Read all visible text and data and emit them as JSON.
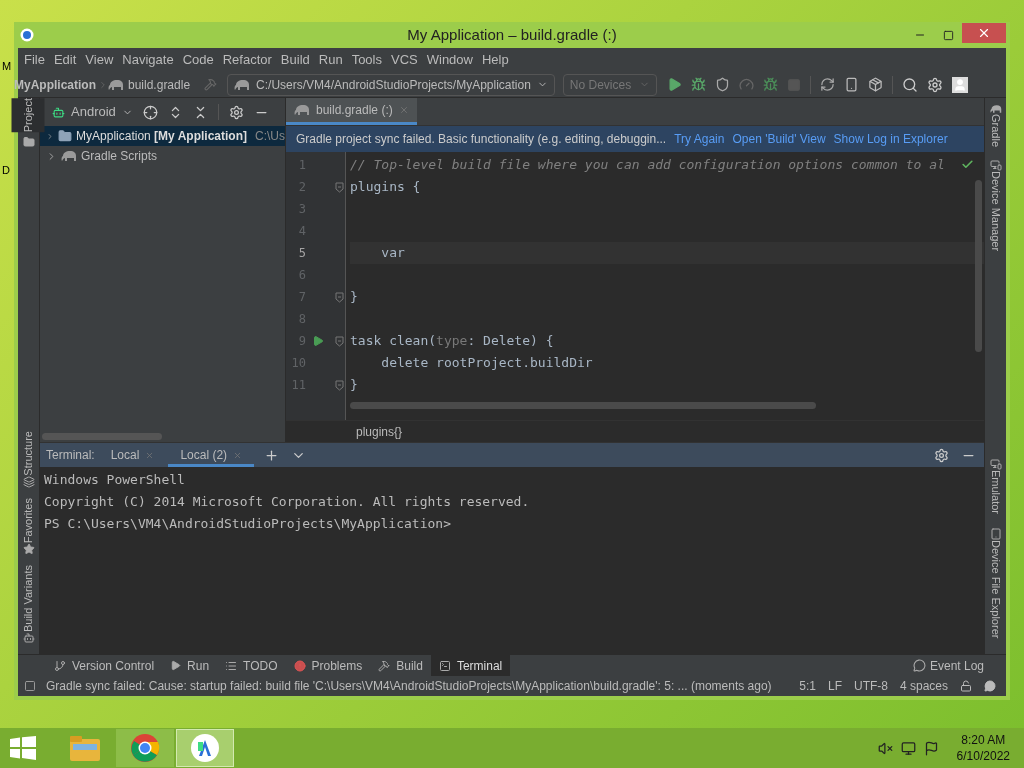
{
  "desktop": {
    "icon_labels": [
      "M",
      "D"
    ]
  },
  "window": {
    "title": "My Application – build.gradle (:)"
  },
  "menu": [
    "File",
    "Edit",
    "View",
    "Navigate",
    "Code",
    "Refactor",
    "Build",
    "Run",
    "Tools",
    "VCS",
    "Window",
    "Help"
  ],
  "navbar": {
    "project": "MyApplication",
    "file": "build.gradle",
    "config": "C:/Users/VM4/AndroidStudioProjects/MyApplication",
    "devices": {
      "label": "No Devices",
      "disabled": true
    }
  },
  "left_stripe": [
    {
      "label": "Project",
      "selected": true
    },
    {
      "label": "Structure",
      "selected": false
    },
    {
      "label": "Favorites",
      "selected": false
    },
    {
      "label": "Build Variants",
      "selected": false
    }
  ],
  "right_stripe": [
    {
      "label": "Gradle"
    },
    {
      "label": "Device Manager"
    },
    {
      "label": "Emulator"
    },
    {
      "label": "Device File Explorer"
    }
  ],
  "project_panel": {
    "view": "Android",
    "tree": [
      {
        "label": "MyApplication **[My Application]**",
        "path": "C:\\Us",
        "kind": "module",
        "expanded": false,
        "selected": true
      },
      {
        "label": "Gradle Scripts",
        "kind": "gradle",
        "expanded": false,
        "selected": false
      }
    ]
  },
  "editor": {
    "tabs": [
      {
        "label": "build.gradle (:)",
        "selected": true
      }
    ],
    "banner": {
      "message": "Gradle project sync failed. Basic functionality (e.g. editing, debuggin...",
      "links": [
        "Try Again",
        "Open 'Build' View",
        "Show Log in Explorer"
      ]
    },
    "lines": [
      {
        "number": "1",
        "fold": false,
        "run": false,
        "selected": false,
        "segments": [
          {
            "kind": "comment",
            "text": "// Top-level build file where you can add configuration options common to al"
          }
        ]
      },
      {
        "number": "2",
        "fold": true,
        "run": false,
        "selected": false,
        "segments": [
          {
            "kind": "text",
            "text": "plugins {"
          }
        ]
      },
      {
        "number": "3",
        "fold": false,
        "run": false,
        "selected": false
      },
      {
        "number": "4",
        "fold": false,
        "run": false,
        "selected": false
      },
      {
        "number": "5",
        "fold": false,
        "run": false,
        "selected": true,
        "segments": [
          {
            "kind": "text",
            "text": "    var"
          }
        ]
      },
      {
        "number": "6",
        "fold": false,
        "run": false,
        "selected": false
      },
      {
        "number": "7",
        "fold": true,
        "run": false,
        "selected": false,
        "segments": [
          {
            "kind": "text",
            "text": "}"
          }
        ]
      },
      {
        "number": "8",
        "fold": false,
        "run": false,
        "selected": false
      },
      {
        "number": "9",
        "fold": true,
        "run": true,
        "selected": false,
        "segments": [
          {
            "kind": "text",
            "text": "task clean("
          },
          {
            "kind": "param",
            "text": "type"
          },
          {
            "kind": "text",
            "text": ": Delete) {"
          }
        ]
      },
      {
        "number": "10",
        "fold": false,
        "run": false,
        "selected": false,
        "segments": [
          {
            "kind": "text",
            "text": "    delete rootProject.buildDir"
          }
        ]
      },
      {
        "number": "11",
        "fold": true,
        "run": false,
        "selected": false,
        "segments": [
          {
            "kind": "text",
            "text": "}"
          }
        ]
      }
    ],
    "breadcrumb": "plugins{}"
  },
  "terminal": {
    "title": "Terminal:",
    "tabs": [
      {
        "label": "Local",
        "selected": false
      },
      {
        "label": "Local (2)",
        "selected": true
      }
    ],
    "output": [
      "Windows PowerShell",
      "Copyright (C) 2014 Microsoft Corporation. All rights reserved.",
      "PS C:\\Users\\VM4\\AndroidStudioProjects\\MyApplication>"
    ]
  },
  "tool_tabs": [
    {
      "label": "Version Control",
      "kind": "vcs",
      "selected": false
    },
    {
      "label": "Run",
      "kind": "run",
      "selected": false
    },
    {
      "label": "TODO",
      "kind": "todo",
      "selected": false
    },
    {
      "label": "Problems",
      "kind": "problems",
      "selected": false
    },
    {
      "label": "Build",
      "kind": "build",
      "selected": false
    },
    {
      "label": "Terminal",
      "kind": "terminal",
      "selected": true
    }
  ],
  "event_log": "Event Log",
  "status_bar": {
    "message": "Gradle sync failed: Cause: startup failed: build file 'C:\\Users\\VM4\\AndroidStudioProjects\\MyApplication\\build.gradle': 5: ... (moments ago)",
    "items": [
      "5:1",
      "LF",
      "UTF-8",
      "4 spaces"
    ]
  },
  "taskbar": {
    "apps": [
      {
        "kind": "explorer",
        "selected": false
      },
      {
        "kind": "chrome",
        "selected": false
      },
      {
        "kind": "studio",
        "selected": true
      }
    ],
    "time": "8:20 AM",
    "date": "6/10/2022"
  }
}
